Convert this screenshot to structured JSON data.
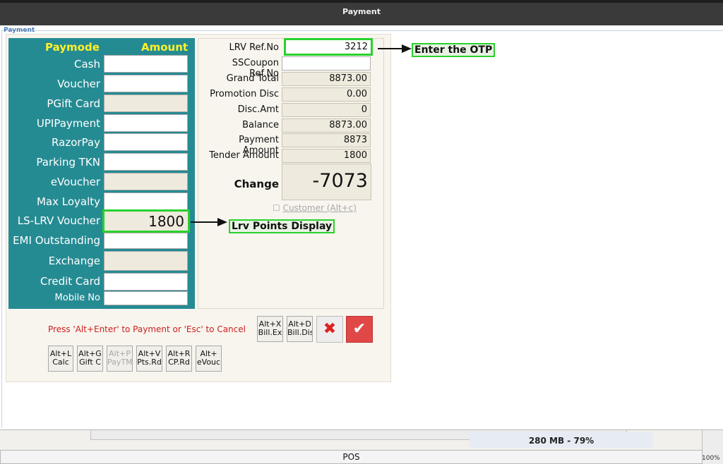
{
  "window": {
    "title": "Payment"
  },
  "dialog": {
    "caption": "Payment"
  },
  "paymode": {
    "header_paymode": "Paymode",
    "header_amount": "Amount",
    "rows": [
      {
        "label": "Cash",
        "value": ""
      },
      {
        "label": "Voucher",
        "value": ""
      },
      {
        "label": "PGift Card",
        "value": ""
      },
      {
        "label": "UPIPayment",
        "value": ""
      },
      {
        "label": "RazorPay",
        "value": ""
      },
      {
        "label": "Parking TKN",
        "value": ""
      },
      {
        "label": "eVoucher",
        "value": ""
      },
      {
        "label": "Max Loyalty",
        "value": ""
      },
      {
        "label": "LS-LRV Voucher",
        "value": "1800"
      },
      {
        "label": "EMI Outstanding",
        "value": ""
      },
      {
        "label": "Exchange",
        "value": ""
      },
      {
        "label": "Credit Card",
        "value": ""
      },
      {
        "label": "Mobile No",
        "value": ""
      }
    ]
  },
  "info": {
    "lrv_ref_label": "LRV Ref.No",
    "lrv_ref_value": "3212",
    "sscoupon_label": "SSCoupon Ref.No",
    "sscoupon_value": "",
    "grand_total_label": "Grand Total",
    "grand_total_value": "8873.00",
    "promo_label": "Promotion Disc",
    "promo_value": "0.00",
    "disc_label": "Disc.Amt",
    "disc_value": "0",
    "balance_label": "Balance",
    "balance_value": "8873.00",
    "payment_amount_label": "Payment Amount",
    "payment_amount_value": "8873",
    "tender_label": "Tender Amount",
    "tender_value": "1800",
    "change_label": "Change",
    "change_value": "-7073",
    "customer_checkbox_label": "Customer (Alt+c)"
  },
  "annotations": {
    "otp": "Enter the OTP",
    "lrv_points": "Lrv Points Display"
  },
  "hint": "Press 'Alt+Enter' to Payment or 'Esc' to Cancel",
  "buttons": {
    "bill_ex": {
      "l1": "Alt+X",
      "l2": "Bill.Ex"
    },
    "bill_dis": {
      "l1": "Alt+D",
      "l2": "Bill.Dis"
    },
    "calc": {
      "l1": "Alt+L",
      "l2": "Calc"
    },
    "gift": {
      "l1": "Alt+G",
      "l2": "Gift C"
    },
    "paytm": {
      "l1": "Alt+P",
      "l2": "PayTM"
    },
    "pts": {
      "l1": "Alt+V",
      "l2": "Pts.Rd"
    },
    "cp": {
      "l1": "Alt+R",
      "l2": "CP.Rd"
    },
    "evouc": {
      "l1": "Alt+",
      "l2": "eVouc"
    },
    "cancel_glyph": "✖",
    "ok_glyph": "✔"
  },
  "background": {
    "memory": "280 MB - 79%",
    "status": "POS",
    "zoom": "100%"
  },
  "colors": {
    "panel_teal": "#258b93",
    "header_yellow": "#fff12a",
    "highlight_green": "#29d12d",
    "hint_red": "#cc2020"
  }
}
